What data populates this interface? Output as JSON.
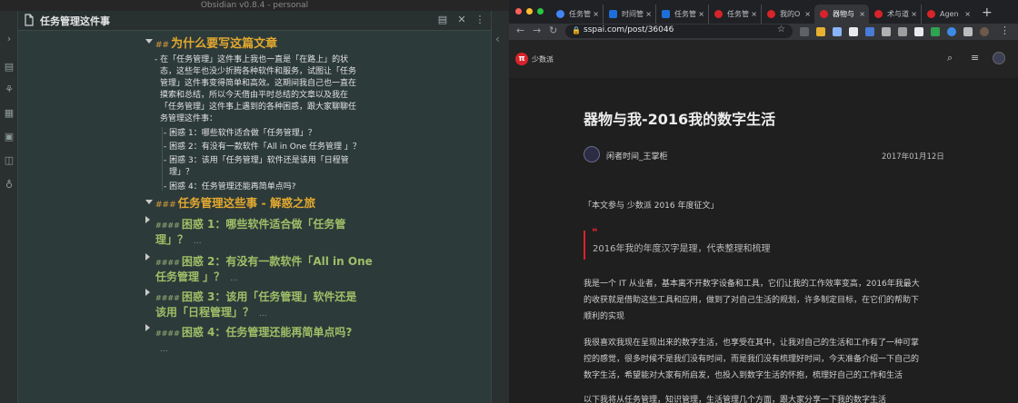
{
  "obsidian": {
    "window_title": "Obsidian v0.8.4 - personal",
    "note_title": "任务管理这件事",
    "h2_marker": "##",
    "h2_text": "为什么要写这篇文章",
    "intro": [
      "- 在「任务管理」这件事上我也一直是「在路上」的状",
      "态，这些年也没少折腾各种软件和服务，试图让「任务",
      "管理」这件事变得简单和高效。这期间我自己也一直在",
      "摸索和总结，所以今天借由平时总结的文章以及我在",
      "「任务管理」这件事上遇到的各种困惑，跟大家聊聊任",
      "务管理这件事："
    ],
    "bullets": [
      "- 困惑 1：哪些软件适合做「任务管理」？",
      "- 困惑 2：有没有一款软件「All in One 任务管理 」？",
      "- 困惑 3：该用「任务管理」软件还是该用「日程管",
      "理」？",
      "- 困惑 4：任务管理还能再简单点吗?"
    ],
    "h3_marker": "###",
    "h3_text": "任务管理这些事 - 解惑之旅",
    "h4_marker": "####",
    "h4_items": [
      {
        "line1": "困惑 1：哪些软件适合做「任务管",
        "line2": "理」？",
        "ellipsis": "..."
      },
      {
        "line1": "困惑 2：有没有一款软件「All in One",
        "line2": "任务管理 」？",
        "ellipsis": "..."
      },
      {
        "line1": "困惑 3：该用「任务管理」软件还是",
        "line2": "该用「日程管理」？",
        "ellipsis": "..."
      },
      {
        "line1": "困惑 4：任务管理还能再简单点吗?",
        "line2": "",
        "ellipsis": "..."
      }
    ]
  },
  "chrome": {
    "tabs": [
      {
        "label": "任务管",
        "favicon": "#4285f4",
        "active": false
      },
      {
        "label": "时间管",
        "favicon": "#1e6fd9",
        "active": false
      },
      {
        "label": "任务管",
        "favicon": "#1e6fd9",
        "active": false
      },
      {
        "label": "任务管",
        "favicon": "#d8232a",
        "active": false
      },
      {
        "label": "我的O",
        "favicon": "#d8232a",
        "active": false
      },
      {
        "label": "器物与",
        "favicon": "#d8232a",
        "active": true
      },
      {
        "label": "术与道",
        "favicon": "#d8232a",
        "active": false
      },
      {
        "label": "Agen",
        "favicon": "#d8232a",
        "active": false
      }
    ],
    "close_glyph": "×",
    "url": "sspai.com/post/36046",
    "site_name": "少数派",
    "site_logo_letter": "π",
    "article": {
      "title": "器物与我-2016我的数字生活",
      "author": "闲者时间_王掌柜",
      "date": "2017年01月12日",
      "lead": "「本文参与 少数派 2016 年度征文」",
      "quote_mark": "❝",
      "quote": "2016年我的年度汉字是理，代表整理和梳理",
      "para1": [
        "我是一个 IT 从业者，基本离不开数字设备和工具，它们让我的工作效率变高，2016年我最大",
        "的收获就是借助这些工具和应用，做到了对自己生活的规划，许多制定目标，在它们的帮助下",
        "顺利的实现"
      ],
      "para2": [
        "我很喜欢我现在呈现出来的数字生活，也享受在其中，让我对自己的生活和工作有了一种可掌",
        "控的感觉，很多时候不是我们没有时间，而是我们没有梳理好时间，今天准备介绍一下自己的",
        "数字生活，希望能对大家有所启发，也投入到数字生活的怀抱，梳理好自己的工作和生活"
      ],
      "para3": "以下我将从任务管理，知识管理，生活管理几个方面，跟大家分享一下我的数字生活"
    }
  }
}
